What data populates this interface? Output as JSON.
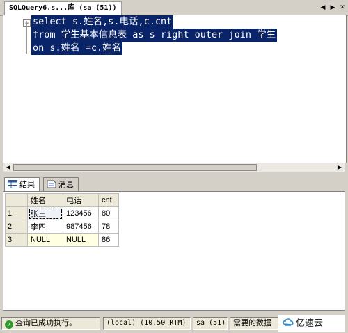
{
  "tab": {
    "title": "SQLQuery6.s...库 (sa (51))"
  },
  "editor": {
    "lines": [
      "select s.姓名,s.电话,c.cnt",
      "from 学生基本信息表 as s right outer join 学生",
      "on s.姓名 =c.姓名"
    ]
  },
  "results": {
    "tabs": [
      {
        "label": "结果",
        "icon": "grid-icon",
        "active": true
      },
      {
        "label": "消息",
        "icon": "message-icon",
        "active": false
      }
    ],
    "columns": [
      "姓名",
      "电话",
      "cnt"
    ],
    "rows": [
      {
        "num": "1",
        "cells": [
          "张三",
          "123456",
          "80"
        ]
      },
      {
        "num": "2",
        "cells": [
          "李四",
          "987456",
          "78"
        ]
      },
      {
        "num": "3",
        "cells": [
          "NULL",
          "NULL",
          "86"
        ]
      }
    ]
  },
  "status": {
    "message": "查询已成功执行。",
    "server": "(local) (10.50 RTM)",
    "user": "sa (51)",
    "database": "需要的数据"
  },
  "watermark": {
    "text": "亿速云"
  },
  "colors": {
    "selection": "#0a246a",
    "null_cell": "#ffffe1",
    "success": "#2e9b2e"
  }
}
